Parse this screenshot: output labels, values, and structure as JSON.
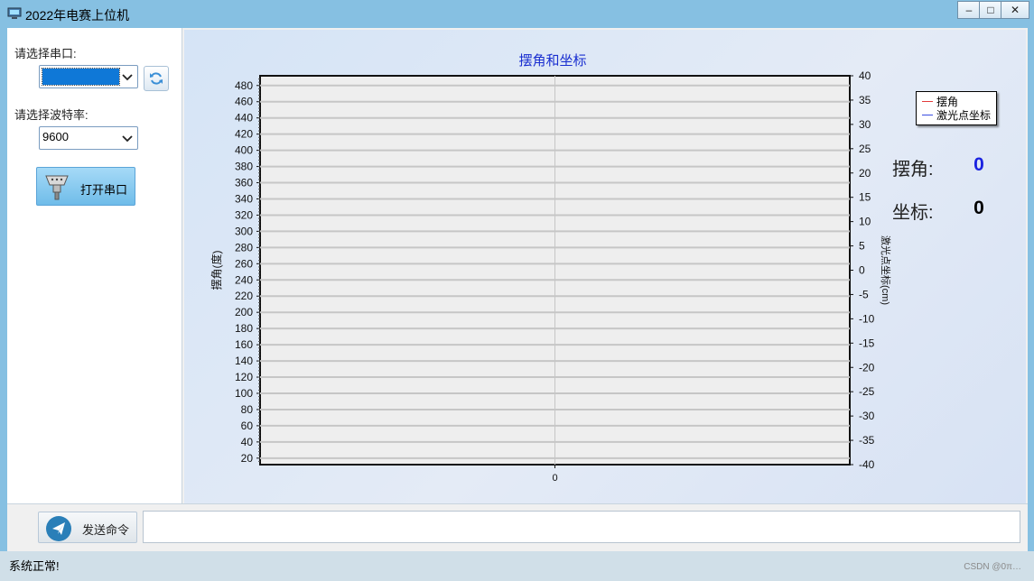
{
  "window": {
    "title": "2022年电赛上位机",
    "controls": {
      "minimize": "–",
      "maximize": "□",
      "close": "✕"
    }
  },
  "left_panel": {
    "port_label": "请选择串口:",
    "port_value": "",
    "baud_label": "请选择波特率:",
    "baud_value": "9600",
    "open_button": "打开串口"
  },
  "readouts": {
    "angle_label": "摆角:",
    "angle_value": "0",
    "angle_color": "#1a22e0",
    "coord_label": "坐标:",
    "coord_value": "0",
    "coord_color": "#000000"
  },
  "send": {
    "button": "发送命令",
    "command_value": ""
  },
  "status": {
    "text": "系统正常!",
    "watermark": "CSDN @0π…"
  },
  "icons": {
    "app": "computer-icon",
    "refresh": "refresh-icon",
    "serial": "serial-connector-icon",
    "send": "paper-plane-icon"
  },
  "chart_data": {
    "type": "line",
    "title": "摆角和坐标",
    "ylabel": "摆角(度)",
    "y2label": "激光点坐标(cm)",
    "x_ticks": [
      "0"
    ],
    "y_ticks": [
      20,
      40,
      60,
      80,
      100,
      120,
      140,
      160,
      180,
      200,
      220,
      240,
      260,
      280,
      300,
      320,
      340,
      360,
      380,
      400,
      420,
      440,
      460,
      480
    ],
    "y2_ticks": [
      -40,
      -35,
      -30,
      -25,
      -20,
      -15,
      -10,
      -5,
      0,
      5,
      10,
      15,
      20,
      25,
      30,
      35,
      40
    ],
    "ylim": [
      12,
      492
    ],
    "y2lim": [
      -40,
      40
    ],
    "legend": "top-right",
    "series": [
      {
        "name": "摆角",
        "color": "#e23b3b",
        "values": []
      },
      {
        "name": "激光点坐标",
        "color": "#3b4de2",
        "values": []
      }
    ]
  }
}
